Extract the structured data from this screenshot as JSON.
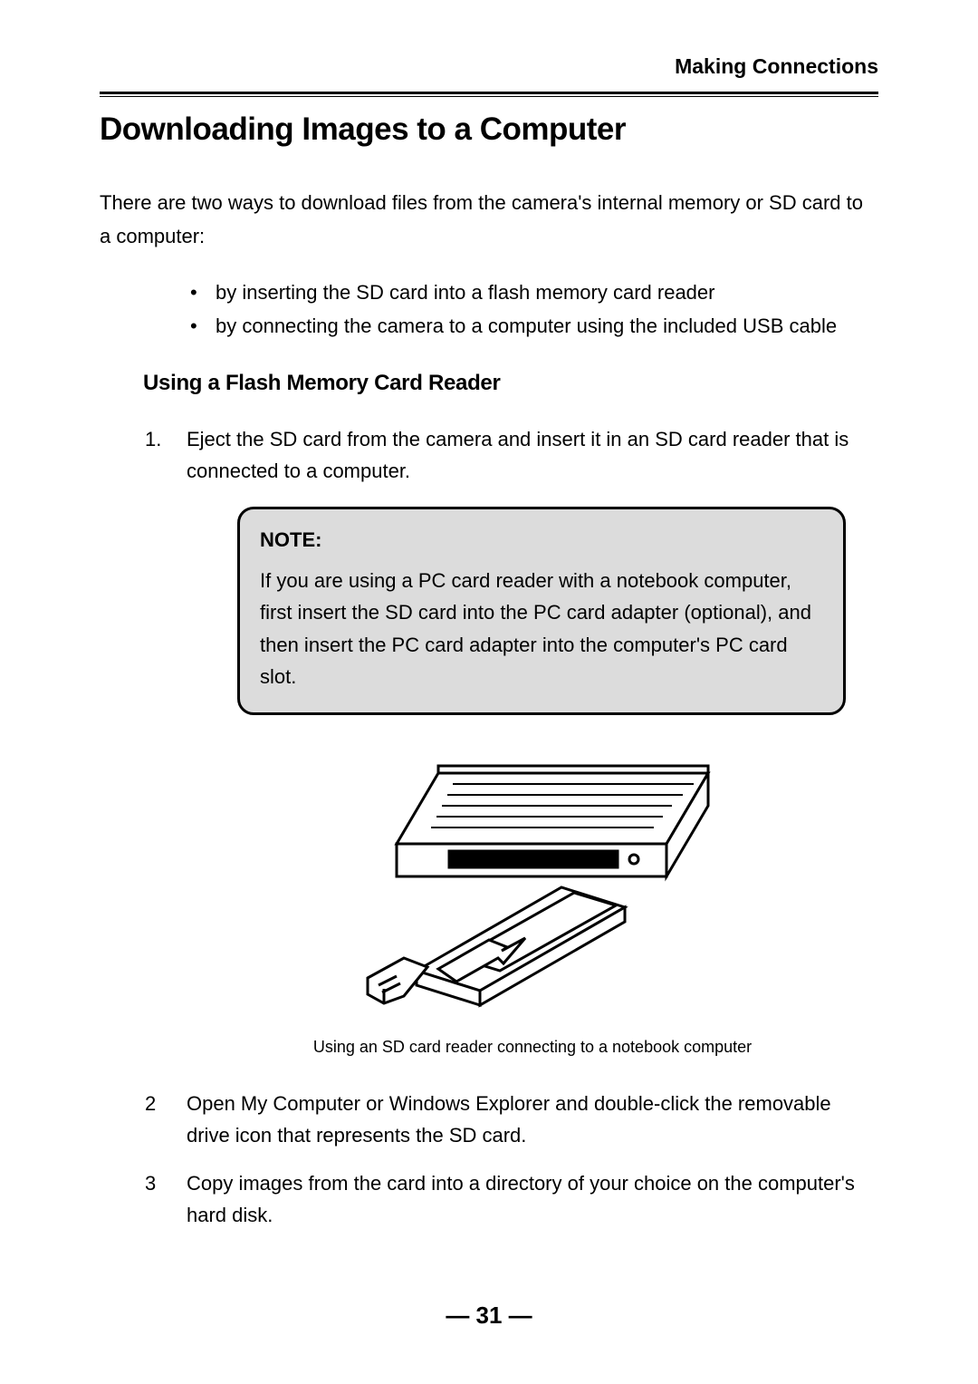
{
  "chapter": "Making Connections",
  "title": "Downloading Images to a Computer",
  "intro": "There are two ways to download files from the camera's internal memory or SD card to a computer:",
  "bullets": [
    "by inserting the SD card into a flash memory card reader",
    "by connecting the camera to a computer using the included USB cable"
  ],
  "subhead": "Using a Flash Memory Card Reader",
  "steps": [
    {
      "num": "1.",
      "text": "Eject the SD card from the camera and insert it in an SD card reader that is connected to a computer."
    },
    {
      "num": "2",
      "text": "Open My Computer or Windows Explorer and double-click the removable drive icon that represents the SD card."
    },
    {
      "num": "3",
      "text": "Copy images from the card into a directory of your choice on the computer's hard disk."
    }
  ],
  "note": {
    "title": "NOTE:",
    "body": "If you are using a PC card reader with a notebook computer, first insert the SD card into the PC card adapter (optional), and then insert the PC card adapter into the computer's PC card slot."
  },
  "figure_caption": "Using an SD card reader connecting to a notebook computer",
  "page_number": "— 31 —",
  "figure_alt": "Illustration of an SD card in a PC-card adapter being inserted into a notebook computer slot"
}
